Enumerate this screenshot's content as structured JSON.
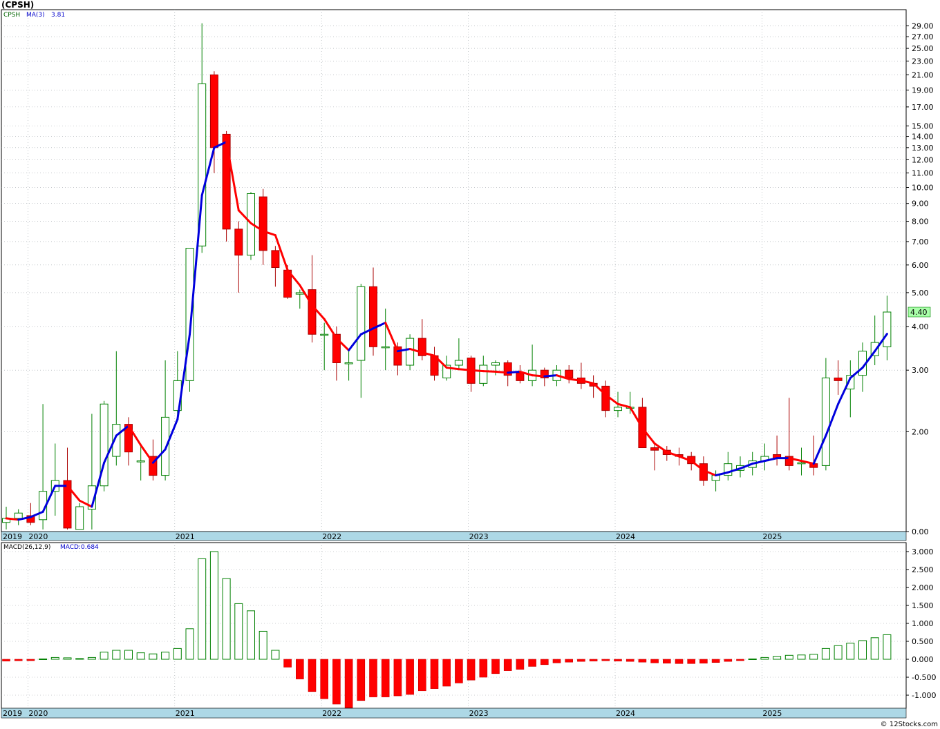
{
  "title": "(CPSH)",
  "watermark": "© 12Stocks.com",
  "colors": {
    "up": "#008000",
    "down": "#ff0000",
    "ma_up": "#0000dd",
    "ma_down": "#ff0000",
    "axis_bar": "#add8e6",
    "grid": "#9aa0a6",
    "last_bg": "#aaffaa"
  },
  "price_panel": {
    "legend_symbol": "CPSH",
    "legend_ma": "MA(3)",
    "legend_ma_value": "3.81",
    "last_price_label": "4.40",
    "scale": "log",
    "y_ticks": [
      "29.00",
      "27.00",
      "25.00",
      "23.00",
      "21.00",
      "19.00",
      "17.00",
      "15.00",
      "14.00",
      "13.00",
      "12.00",
      "11.00",
      "10.00",
      "9.00",
      "8.00",
      "7.00",
      "6.00",
      "5.00",
      "4.00",
      "3.00",
      "2.00",
      "0.00"
    ]
  },
  "macd_panel": {
    "legend_macd": "MACD(26,12,9)",
    "legend_value": "MACD:0.684",
    "y_ticks": [
      "3.000",
      "2.500",
      "2.000",
      "1.500",
      "1.000",
      "0.500",
      "0.000",
      "-0.500",
      "-1.000"
    ]
  },
  "x_labels": [
    "2019",
    "2020",
    "2021",
    "2022",
    "2023",
    "2024",
    "2025"
  ],
  "chart_data": {
    "type": "candlestick",
    "period": "monthly",
    "title": "(CPSH)",
    "y_scale": "log",
    "ylim": [
      1.05,
      30
    ],
    "x_labels": [
      "2019",
      "2020",
      "2021",
      "2022",
      "2023",
      "2024",
      "2025"
    ],
    "first_month": "2019-11",
    "candles": [
      [
        1.1,
        1.22,
        1.05,
        1.13
      ],
      [
        1.13,
        1.2,
        1.08,
        1.17
      ],
      [
        1.15,
        1.25,
        1.08,
        1.1
      ],
      [
        1.12,
        2.4,
        1.05,
        1.35
      ],
      [
        1.35,
        1.85,
        1.15,
        1.45
      ],
      [
        1.45,
        1.8,
        1.05,
        1.06
      ],
      [
        1.05,
        1.25,
        1.05,
        1.22
      ],
      [
        1.2,
        2.25,
        1.05,
        1.4
      ],
      [
        1.4,
        2.45,
        1.35,
        2.4
      ],
      [
        1.7,
        3.4,
        1.6,
        2.1
      ],
      [
        2.1,
        2.2,
        1.6,
        1.75
      ],
      [
        1.65,
        1.85,
        1.45,
        1.65
      ],
      [
        1.7,
        1.9,
        1.45,
        1.5
      ],
      [
        1.5,
        3.2,
        1.45,
        2.2
      ],
      [
        2.3,
        3.4,
        2.2,
        2.8
      ],
      [
        2.8,
        5.0,
        2.6,
        6.7
      ],
      [
        6.8,
        29.5,
        6.5,
        19.8
      ],
      [
        21.0,
        21.5,
        11.0,
        13.0
      ],
      [
        14.2,
        14.5,
        7.0,
        7.6
      ],
      [
        7.6,
        8.0,
        5.0,
        6.4
      ],
      [
        6.4,
        9.7,
        6.2,
        9.6
      ],
      [
        9.4,
        9.9,
        6.0,
        6.6
      ],
      [
        6.6,
        6.8,
        5.2,
        5.9
      ],
      [
        5.8,
        6.0,
        4.8,
        4.85
      ],
      [
        4.95,
        5.1,
        4.5,
        5.0
      ],
      [
        5.1,
        6.4,
        3.6,
        3.8
      ],
      [
        3.8,
        4.1,
        3.0,
        3.8
      ],
      [
        3.8,
        4.0,
        2.8,
        3.15
      ],
      [
        3.15,
        3.4,
        2.8,
        3.15
      ],
      [
        3.2,
        5.3,
        2.5,
        5.2
      ],
      [
        5.2,
        5.9,
        3.3,
        3.5
      ],
      [
        3.5,
        4.5,
        3.0,
        3.5
      ],
      [
        3.5,
        3.6,
        2.9,
        3.1
      ],
      [
        3.1,
        3.8,
        3.0,
        3.7
      ],
      [
        3.7,
        4.2,
        3.2,
        3.3
      ],
      [
        3.3,
        3.5,
        2.8,
        2.9
      ],
      [
        2.85,
        3.3,
        2.8,
        3.1
      ],
      [
        3.1,
        3.7,
        3.0,
        3.2
      ],
      [
        3.25,
        3.3,
        2.6,
        2.75
      ],
      [
        2.75,
        3.3,
        2.7,
        3.1
      ],
      [
        3.1,
        3.2,
        2.9,
        3.15
      ],
      [
        3.15,
        3.2,
        2.7,
        2.9
      ],
      [
        2.95,
        3.1,
        2.75,
        2.8
      ],
      [
        2.8,
        3.55,
        2.7,
        3.0
      ],
      [
        3.0,
        3.05,
        2.7,
        2.85
      ],
      [
        2.8,
        3.1,
        2.7,
        3.0
      ],
      [
        3.0,
        3.1,
        2.75,
        2.85
      ],
      [
        2.85,
        3.15,
        2.65,
        2.75
      ],
      [
        2.75,
        2.9,
        2.5,
        2.7
      ],
      [
        2.7,
        2.8,
        2.2,
        2.3
      ],
      [
        2.3,
        2.6,
        2.2,
        2.35
      ],
      [
        2.35,
        2.6,
        2.25,
        2.35
      ],
      [
        2.35,
        2.5,
        1.9,
        1.8
      ],
      [
        1.8,
        1.85,
        1.55,
        1.77
      ],
      [
        1.77,
        1.82,
        1.65,
        1.72
      ],
      [
        1.72,
        1.8,
        1.6,
        1.7
      ],
      [
        1.7,
        1.75,
        1.55,
        1.62
      ],
      [
        1.62,
        1.7,
        1.4,
        1.45
      ],
      [
        1.45,
        1.55,
        1.35,
        1.5
      ],
      [
        1.5,
        1.75,
        1.45,
        1.62
      ],
      [
        1.55,
        1.7,
        1.48,
        1.6
      ],
      [
        1.58,
        1.75,
        1.5,
        1.65
      ],
      [
        1.65,
        1.85,
        1.55,
        1.7
      ],
      [
        1.72,
        1.95,
        1.6,
        1.68
      ],
      [
        1.7,
        2.5,
        1.55,
        1.6
      ],
      [
        1.63,
        1.8,
        1.5,
        1.63
      ],
      [
        1.62,
        1.95,
        1.5,
        1.58
      ],
      [
        1.6,
        3.25,
        1.55,
        2.85
      ],
      [
        2.85,
        3.2,
        2.55,
        2.8
      ],
      [
        2.65,
        3.2,
        2.2,
        2.9
      ],
      [
        2.9,
        3.6,
        2.6,
        3.4
      ],
      [
        3.3,
        4.3,
        3.1,
        3.6
      ],
      [
        3.5,
        4.9,
        3.2,
        4.4
      ]
    ],
    "ma3": [
      1.13,
      1.12,
      1.14,
      1.18,
      1.4,
      1.4,
      1.27,
      1.22,
      1.63,
      1.95,
      2.08,
      1.83,
      1.63,
      1.78,
      2.17,
      3.8,
      9.5,
      13.0,
      13.5,
      8.6,
      7.9,
      7.5,
      7.3,
      5.8,
      5.25,
      4.6,
      4.2,
      3.7,
      3.42,
      3.8,
      3.95,
      4.1,
      3.4,
      3.45,
      3.37,
      3.3,
      3.05,
      3.02,
      3.0,
      2.98,
      2.97,
      2.95,
      2.97,
      2.9,
      2.88,
      2.9,
      2.83,
      2.8,
      2.75,
      2.55,
      2.4,
      2.35,
      2.05,
      1.85,
      1.75,
      1.7,
      1.65,
      1.55,
      1.5,
      1.53,
      1.57,
      1.62,
      1.65,
      1.68,
      1.68,
      1.65,
      1.62,
      1.95,
      2.4,
      2.85,
      3.05,
      3.4,
      3.81
    ],
    "macd_histogram": [
      -0.05,
      -0.04,
      -0.03,
      0.01,
      0.05,
      0.04,
      0.02,
      0.05,
      0.2,
      0.25,
      0.25,
      0.18,
      0.15,
      0.2,
      0.3,
      0.85,
      2.8,
      3.0,
      2.25,
      1.55,
      1.35,
      0.78,
      0.25,
      -0.22,
      -0.55,
      -0.9,
      -1.1,
      -1.25,
      -1.35,
      -1.15,
      -1.05,
      -1.05,
      -1.02,
      -0.98,
      -0.88,
      -0.82,
      -0.75,
      -0.66,
      -0.58,
      -0.5,
      -0.4,
      -0.32,
      -0.28,
      -0.2,
      -0.15,
      -0.1,
      -0.08,
      -0.06,
      -0.05,
      -0.04,
      -0.05,
      -0.06,
      -0.08,
      -0.1,
      -0.11,
      -0.12,
      -0.12,
      -0.11,
      -0.09,
      -0.06,
      -0.03,
      0.01,
      0.05,
      0.08,
      0.11,
      0.12,
      0.14,
      0.3,
      0.38,
      0.45,
      0.52,
      0.6,
      0.684
    ]
  }
}
